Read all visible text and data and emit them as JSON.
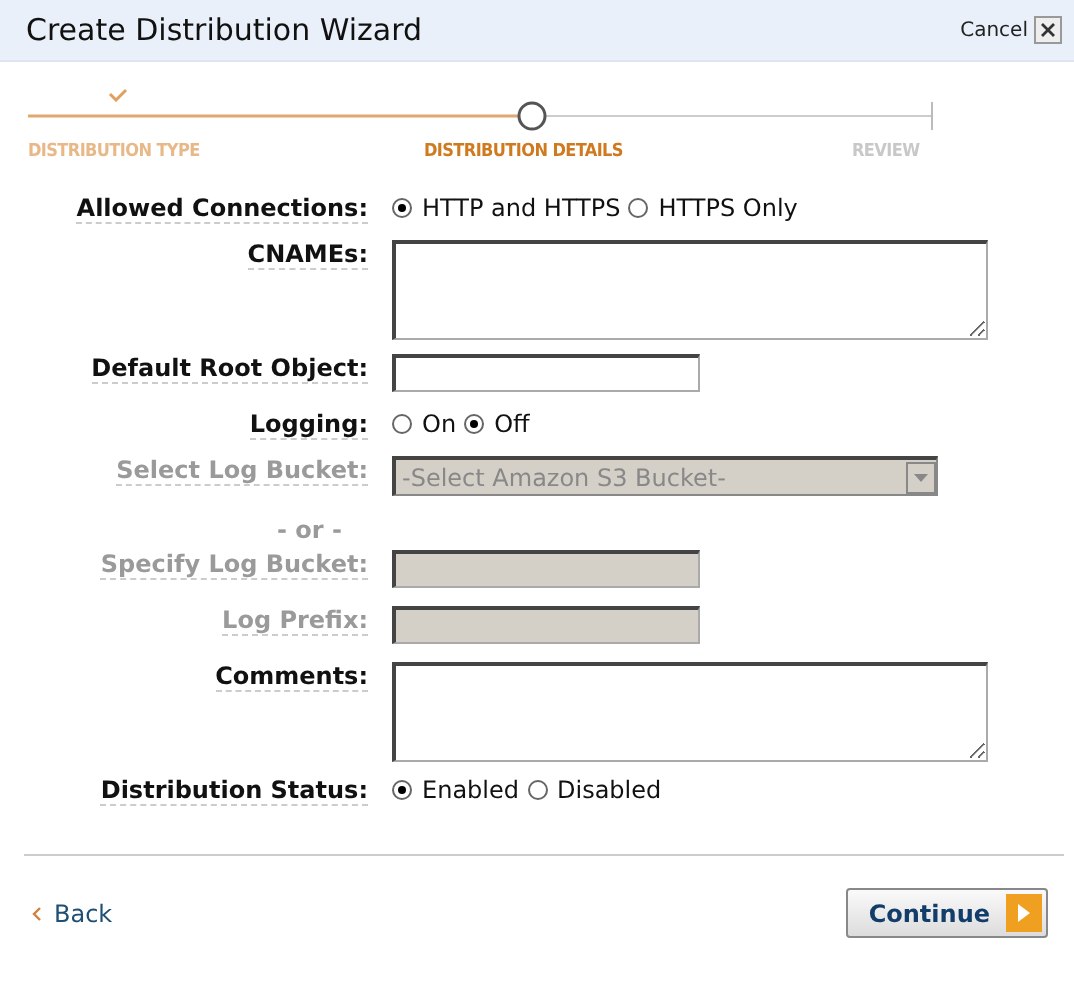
{
  "window": {
    "title": "Create Distribution Wizard",
    "cancel": "Cancel"
  },
  "steps": [
    {
      "label": "DISTRIBUTION TYPE",
      "completed": true,
      "selected": false
    },
    {
      "label": "DISTRIBUTION DETAILS",
      "completed": false,
      "selected": true
    },
    {
      "label": "REVIEW",
      "completed": false,
      "selected": false
    }
  ],
  "fields": [
    {
      "kind": "radio",
      "label": "Allowed Connections:",
      "disabled": false,
      "options": [
        {
          "label": "HTTP and HTTPS",
          "selected": true
        },
        {
          "label": "HTTPS Only",
          "selected": false
        }
      ]
    },
    {
      "kind": "textarea",
      "label": "CNAMEs:",
      "disabled": false
    },
    {
      "kind": "text",
      "label": "Default Root Object:",
      "disabled": false
    },
    {
      "kind": "radio",
      "label": "Logging:",
      "disabled": false,
      "options": [
        {
          "label": "On",
          "selected": false
        },
        {
          "label": "Off",
          "selected": true
        }
      ]
    },
    {
      "kind": "select",
      "label": "Select Log Bucket:",
      "disabled": true,
      "value": "-Select Amazon S3 Bucket-"
    },
    {
      "kind": "separator",
      "label": "- or -",
      "disabled": true
    },
    {
      "kind": "text",
      "label": "Specify Log Bucket:",
      "disabled": true
    },
    {
      "kind": "text",
      "label": "Log Prefix:",
      "disabled": true
    },
    {
      "kind": "textarea",
      "label": "Comments:",
      "disabled": false
    },
    {
      "kind": "radio",
      "label": "Distribution Status:",
      "disabled": false,
      "options": [
        {
          "label": "Enabled",
          "selected": true
        },
        {
          "label": "Disabled",
          "selected": false
        }
      ]
    }
  ],
  "footer": {
    "back": "Back",
    "continue": "Continue"
  }
}
